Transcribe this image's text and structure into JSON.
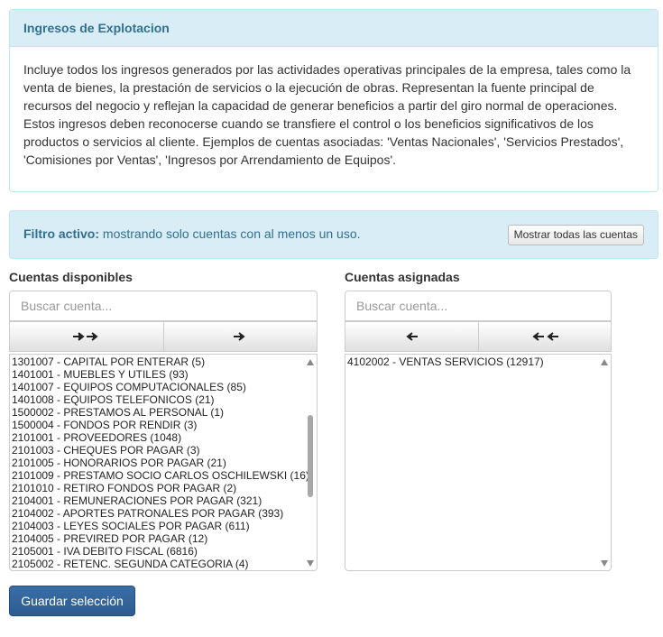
{
  "panel": {
    "title": "Ingresos de Explotacion",
    "body": "Incluye todos los ingresos generados por las actividades operativas principales de la empresa, tales como la venta de bienes, la prestación de servicios o la ejecución de obras. Representan la fuente principal de recursos del negocio y reflejan la capacidad de generar beneficios a partir del giro normal de operaciones. Estos ingresos deben reconocerse cuando se transfiere el control o los beneficios significativos de los productos o servicios al cliente. Ejemplos de cuentas asociadas: 'Ventas Nacionales', 'Servicios Prestados', 'Comisiones por Ventas', 'Ingresos por Arrendamiento de Equipos'."
  },
  "filter": {
    "label": "Filtro activo:",
    "message": " mostrando solo cuentas con al menos un uso.",
    "show_all_label": "Mostrar todas las cuentas"
  },
  "available": {
    "title": "Cuentas disponibles",
    "search_placeholder": "Buscar cuenta...",
    "buttons": [
      {
        "icon": "double-arrow-right-icon"
      },
      {
        "icon": "arrow-right-icon"
      }
    ],
    "scroll_position": 0.3,
    "options": [
      "1301007 - CAPITAL POR ENTERAR (5)",
      "1401001 - MUEBLES Y UTILES (93)",
      "1401007 - EQUIPOS COMPUTACIONALES (85)",
      "1401008 - EQUIPOS TELEFONICOS (21)",
      "1500002 - PRESTAMOS AL PERSONAL (1)",
      "1500004 - FONDOS POR RENDIR (3)",
      "2101001 - PROVEEDORES (1048)",
      "2101003 - CHEQUES POR PAGAR (3)",
      "2101005 - HONORARIOS POR PAGAR (21)",
      "2101009 - PRESTAMO SOCIO CARLOS OSCHILEWSKI (16)",
      "2101010 - RETIRO FONDOS POR PAGAR (2)",
      "2104001 - REMUNERACIONES POR PAGAR (321)",
      "2104002 - APORTES PATRONALES POR PAGAR (393)",
      "2104003 - LEYES SOCIALES POR PAGAR (611)",
      "2104005 - PREVIRED POR PAGAR (12)",
      "2105001 - IVA DEBITO FISCAL (6816)",
      "2105002 - RETENC. SEGUNDA CATEGORIA (4)"
    ]
  },
  "assigned": {
    "title": "Cuentas asignadas",
    "search_placeholder": "Buscar cuenta...",
    "buttons": [
      {
        "icon": "arrow-left-icon"
      },
      {
        "icon": "double-arrow-left-icon"
      }
    ],
    "options": [
      "4102002 - VENTAS SERVICIOS (12917)"
    ]
  },
  "save_label": "Guardar selección"
}
